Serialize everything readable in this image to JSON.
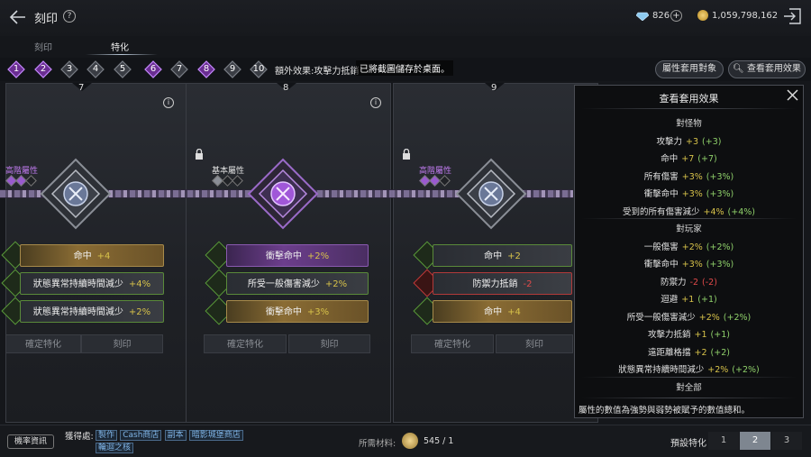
{
  "header": {
    "title": "刻印",
    "help": "?",
    "gems": "826",
    "plus": "+",
    "gold": "1,059,798,162"
  },
  "tabs": [
    {
      "label": "刻印"
    },
    {
      "label": "特化"
    }
  ],
  "steps": [
    {
      "n": "1",
      "state": "active"
    },
    {
      "n": "2",
      "state": "active"
    },
    {
      "n": "3",
      "state": "inactive"
    },
    {
      "n": "4",
      "state": "inactive"
    },
    {
      "n": "5",
      "state": "inactive"
    },
    {
      "n": "6",
      "state": "active"
    },
    {
      "n": "7",
      "state": "inactive"
    },
    {
      "n": "8",
      "state": "active"
    },
    {
      "n": "9",
      "state": "inactive"
    },
    {
      "n": "10",
      "state": "inactive"
    }
  ],
  "extra_effect": "額外效果:攻擊力抵銷",
  "toast": "已將截圖儲存於桌面。",
  "buttons": {
    "attribute_target": "屬性套用對象",
    "view_effect": "查看套用效果"
  },
  "panels": [
    {
      "number": "7",
      "tier": "高階屬性",
      "tier_type": "high",
      "dots": [
        "purple",
        "purple",
        "dark"
      ],
      "stats": [
        {
          "name": "命中",
          "value": "+4",
          "style": "orange"
        },
        {
          "name": "狀態異常持續時間減少",
          "value": "+4%",
          "style": "dark"
        },
        {
          "name": "狀態異常持續時間減少",
          "value": "+2%",
          "style": "dark"
        }
      ],
      "confirm": "確定特化",
      "engrave": "刻印"
    },
    {
      "number": "8",
      "tier": "基本屬性",
      "tier_type": "basic",
      "dots": [
        "gray",
        "dark",
        "dark"
      ],
      "stats": [
        {
          "name": "衝擊命中",
          "value": "+2%",
          "style": "purple"
        },
        {
          "name": "所受一般傷害減少",
          "value": "+2%",
          "style": "dark"
        },
        {
          "name": "衝擊命中",
          "value": "+3%",
          "style": "orange"
        }
      ],
      "confirm": "確定特化",
      "engrave": "刻印"
    },
    {
      "number": "9",
      "tier": "高階屬性",
      "tier_type": "high",
      "dots": [
        "purple",
        "purple",
        "dark"
      ],
      "stats": [
        {
          "name": "命中",
          "value": "+2",
          "style": "dark"
        },
        {
          "name": "防禦力抵銷",
          "value": "-2",
          "style": "red"
        },
        {
          "name": "命中",
          "value": "+4",
          "style": "orange"
        }
      ],
      "confirm": "確定特化",
      "engrave": "刻印"
    }
  ],
  "effect_panel": {
    "title": "查看套用效果",
    "sections": [
      {
        "header": "對怪物",
        "lines": [
          {
            "name": "攻擊力",
            "value": "+3",
            "extra": "(+3)",
            "color": "y"
          },
          {
            "name": "命中",
            "value": "+7",
            "extra": "(+7)",
            "color": "y"
          },
          {
            "name": "所有傷害",
            "value": "+3%",
            "extra": "(+3%)",
            "color": "y"
          },
          {
            "name": "衝擊命中",
            "value": "+3%",
            "extra": "(+3%)",
            "color": "y"
          },
          {
            "name": "受到的所有傷害減少",
            "value": "+4%",
            "extra": "(+4%)",
            "color": "y"
          }
        ]
      },
      {
        "header": "對玩家",
        "lines": [
          {
            "name": "一般傷害",
            "value": "+2%",
            "extra": "(+2%)",
            "color": "y"
          },
          {
            "name": "衝擊命中",
            "value": "+3%",
            "extra": "(+3%)",
            "color": "y"
          },
          {
            "name": "防禦力",
            "value": "-2",
            "extra": "(-2)",
            "color": "r"
          },
          {
            "name": "迴避",
            "value": "+1",
            "extra": "(+1)",
            "color": "y"
          },
          {
            "name": "所受一般傷害減少",
            "value": "+2%",
            "extra": "(+2%)",
            "color": "y"
          },
          {
            "name": "攻擊力抵銷",
            "value": "+1",
            "extra": "(+1)",
            "color": "y"
          },
          {
            "name": "遠距離格擋",
            "value": "+2",
            "extra": "(+2)",
            "color": "y"
          },
          {
            "name": "狀態異常持續時間減少",
            "value": "+2%",
            "extra": "(+2%)",
            "color": "y"
          }
        ]
      },
      {
        "header": "對全部",
        "lines": []
      }
    ],
    "footer": "屬性的數值為強勢與弱勢被賦予的數值總和。"
  },
  "bottom": {
    "probability": "機率資訊",
    "obtain_label": "獲得處:",
    "sources": [
      "製作",
      "Cash商店",
      "副本",
      "暗影城堡商店",
      "輪迴之核"
    ],
    "material_label": "所需材料:",
    "material_count": "545 / 1",
    "preset_label": "預設特化",
    "presets": [
      {
        "label": "1",
        "active": false
      },
      {
        "label": "2",
        "active": true
      },
      {
        "label": "3",
        "active": false
      }
    ]
  },
  "colors": {
    "background": "#15171b",
    "accent_purple": "#8a4ab8",
    "value_yellow": "#d7c24a",
    "value_red": "#e24a4a",
    "value_green": "#8fd06a"
  }
}
